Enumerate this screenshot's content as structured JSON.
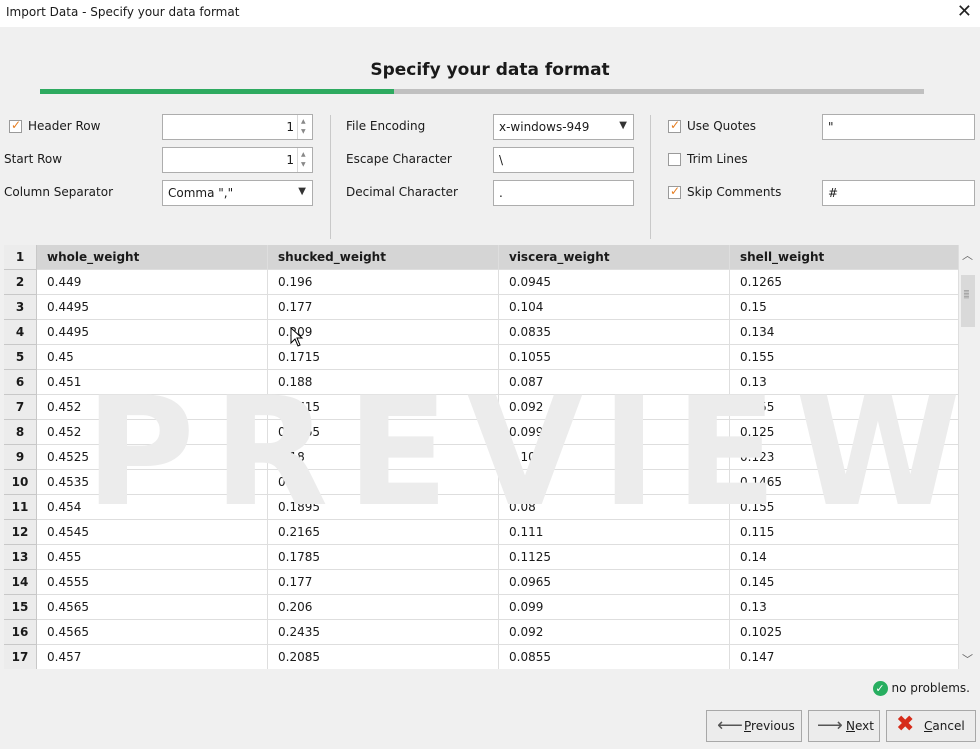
{
  "window": {
    "title": "Import Data - Specify your data format",
    "close_glyph": "✕"
  },
  "heading": "Specify your data format",
  "progress": {
    "fraction": 0.4,
    "color": "#2eaa60"
  },
  "options": {
    "header_row": {
      "label": "Header Row",
      "checked": true,
      "value": "1"
    },
    "start_row": {
      "label": "Start Row",
      "value": "1"
    },
    "column_separator": {
      "label": "Column Separator",
      "value": "Comma \",\""
    },
    "file_encoding": {
      "label": "File Encoding",
      "value": "x-windows-949"
    },
    "escape_character": {
      "label": "Escape Character",
      "value": "\\"
    },
    "decimal_character": {
      "label": "Decimal Character",
      "value": "."
    },
    "use_quotes": {
      "label": "Use Quotes",
      "checked": true,
      "value": "\""
    },
    "trim_lines": {
      "label": "Trim Lines",
      "checked": false
    },
    "skip_comments": {
      "label": "Skip Comments",
      "checked": true,
      "value": "#"
    }
  },
  "table": {
    "watermark": "PREVIEW",
    "header": {
      "num": "1",
      "cols": [
        "whole_weight",
        "shucked_weight",
        "viscera_weight",
        "shell_weight"
      ]
    },
    "rows": [
      {
        "num": "2",
        "cells": [
          "0.449",
          "0.196",
          "0.0945",
          "0.1265"
        ]
      },
      {
        "num": "3",
        "cells": [
          "0.4495",
          "0.177",
          "0.104",
          "0.15"
        ]
      },
      {
        "num": "4",
        "cells": [
          "0.4495",
          "0.209",
          "0.0835",
          "0.134"
        ]
      },
      {
        "num": "5",
        "cells": [
          "0.45",
          "0.1715",
          "0.1055",
          "0.155"
        ]
      },
      {
        "num": "6",
        "cells": [
          "0.451",
          "0.188",
          "0.087",
          "0.13"
        ]
      },
      {
        "num": "7",
        "cells": [
          "0.452",
          "0.1715",
          "0.092",
          "0.155"
        ]
      },
      {
        "num": "8",
        "cells": [
          "0.452",
          "0.2165",
          "0.0995",
          "0.125"
        ]
      },
      {
        "num": "9",
        "cells": [
          "0.4525",
          "0.18",
          "0.103",
          "0.123"
        ]
      },
      {
        "num": "10",
        "cells": [
          "0.4535",
          "0.203",
          "0.08",
          "0.1465"
        ]
      },
      {
        "num": "11",
        "cells": [
          "0.454",
          "0.1895",
          "0.08",
          "0.155"
        ]
      },
      {
        "num": "12",
        "cells": [
          "0.4545",
          "0.2165",
          "0.111",
          "0.115"
        ]
      },
      {
        "num": "13",
        "cells": [
          "0.455",
          "0.1785",
          "0.1125",
          "0.14"
        ]
      },
      {
        "num": "14",
        "cells": [
          "0.4555",
          "0.177",
          "0.0965",
          "0.145"
        ]
      },
      {
        "num": "15",
        "cells": [
          "0.4565",
          "0.206",
          "0.099",
          "0.13"
        ]
      },
      {
        "num": "16",
        "cells": [
          "0.4565",
          "0.2435",
          "0.092",
          "0.1025"
        ]
      },
      {
        "num": "17",
        "cells": [
          "0.457",
          "0.2085",
          "0.0855",
          "0.147"
        ]
      }
    ]
  },
  "status": {
    "text": "no problems.",
    "icon": "check-circle-icon",
    "color": "#27ae60"
  },
  "buttons": {
    "previous": {
      "pre": "",
      "u": "P",
      "post": "revious"
    },
    "next": {
      "pre": "",
      "u": "N",
      "post": "ext"
    },
    "cancel": {
      "pre": "",
      "u": "C",
      "post": "ancel"
    }
  }
}
